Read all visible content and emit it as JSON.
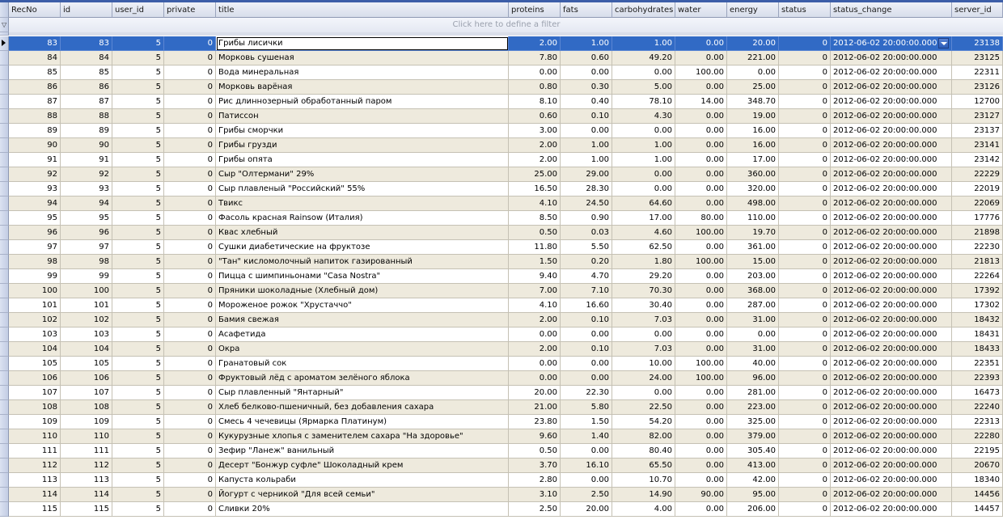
{
  "filter_placeholder": "Click here to define a filter",
  "columns": [
    "RecNo",
    "id",
    "user_id",
    "private",
    "title",
    "proteins",
    "fats",
    "carbohydrates",
    "water",
    "energy",
    "status",
    "status_change",
    "server_id"
  ],
  "selected_index": 0,
  "rows": [
    [
      "83",
      "83",
      "5",
      "0",
      "Грибы лисички",
      "2.00",
      "1.00",
      "1.00",
      "0.00",
      "20.00",
      "0",
      "2012-06-02 20:00:00.000",
      "23138"
    ],
    [
      "84",
      "84",
      "5",
      "0",
      "Морковь сушеная",
      "7.80",
      "0.60",
      "49.20",
      "0.00",
      "221.00",
      "0",
      "2012-06-02 20:00:00.000",
      "23125"
    ],
    [
      "85",
      "85",
      "5",
      "0",
      "Вода минеральная",
      "0.00",
      "0.00",
      "0.00",
      "100.00",
      "0.00",
      "0",
      "2012-06-02 20:00:00.000",
      "22311"
    ],
    [
      "86",
      "86",
      "5",
      "0",
      "Морковь варёная",
      "0.80",
      "0.30",
      "5.00",
      "0.00",
      "25.00",
      "0",
      "2012-06-02 20:00:00.000",
      "23126"
    ],
    [
      "87",
      "87",
      "5",
      "0",
      "Рис длиннозерный обработанный паром",
      "8.10",
      "0.40",
      "78.10",
      "14.00",
      "348.70",
      "0",
      "2012-06-02 20:00:00.000",
      "12700"
    ],
    [
      "88",
      "88",
      "5",
      "0",
      "Патиссон",
      "0.60",
      "0.10",
      "4.30",
      "0.00",
      "19.00",
      "0",
      "2012-06-02 20:00:00.000",
      "23127"
    ],
    [
      "89",
      "89",
      "5",
      "0",
      "Грибы сморчки",
      "3.00",
      "0.00",
      "0.00",
      "0.00",
      "16.00",
      "0",
      "2012-06-02 20:00:00.000",
      "23137"
    ],
    [
      "90",
      "90",
      "5",
      "0",
      "Грибы грузди",
      "2.00",
      "1.00",
      "1.00",
      "0.00",
      "16.00",
      "0",
      "2012-06-02 20:00:00.000",
      "23141"
    ],
    [
      "91",
      "91",
      "5",
      "0",
      "Грибы опята",
      "2.00",
      "1.00",
      "1.00",
      "0.00",
      "17.00",
      "0",
      "2012-06-02 20:00:00.000",
      "23142"
    ],
    [
      "92",
      "92",
      "5",
      "0",
      "Сыр \"Олтермани\" 29%",
      "25.00",
      "29.00",
      "0.00",
      "0.00",
      "360.00",
      "0",
      "2012-06-02 20:00:00.000",
      "22229"
    ],
    [
      "93",
      "93",
      "5",
      "0",
      "Сыр плавленый \"Российский\" 55%",
      "16.50",
      "28.30",
      "0.00",
      "0.00",
      "320.00",
      "0",
      "2012-06-02 20:00:00.000",
      "22019"
    ],
    [
      "94",
      "94",
      "5",
      "0",
      "Твикс",
      "4.10",
      "24.50",
      "64.60",
      "0.00",
      "498.00",
      "0",
      "2012-06-02 20:00:00.000",
      "22069"
    ],
    [
      "95",
      "95",
      "5",
      "0",
      "Фасоль красная Rainsow (Италия)",
      "8.50",
      "0.90",
      "17.00",
      "80.00",
      "110.00",
      "0",
      "2012-06-02 20:00:00.000",
      "17776"
    ],
    [
      "96",
      "96",
      "5",
      "0",
      "Квас хлебный",
      "0.50",
      "0.03",
      "4.60",
      "100.00",
      "19.70",
      "0",
      "2012-06-02 20:00:00.000",
      "21898"
    ],
    [
      "97",
      "97",
      "5",
      "0",
      "Сушки диабетические на фруктозе",
      "11.80",
      "5.50",
      "62.50",
      "0.00",
      "361.00",
      "0",
      "2012-06-02 20:00:00.000",
      "22230"
    ],
    [
      "98",
      "98",
      "5",
      "0",
      "\"Тан\" кисломолочный напиток газированный",
      "1.50",
      "0.20",
      "1.80",
      "100.00",
      "15.00",
      "0",
      "2012-06-02 20:00:00.000",
      "21813"
    ],
    [
      "99",
      "99",
      "5",
      "0",
      "Пицца с шимпиньонами \"Casa Nostra\"",
      "9.40",
      "4.70",
      "29.20",
      "0.00",
      "203.00",
      "0",
      "2012-06-02 20:00:00.000",
      "22264"
    ],
    [
      "100",
      "100",
      "5",
      "0",
      "Пряники шоколадные  (Хлебный дом)",
      "7.00",
      "7.10",
      "70.30",
      "0.00",
      "368.00",
      "0",
      "2012-06-02 20:00:00.000",
      "17392"
    ],
    [
      "101",
      "101",
      "5",
      "0",
      "Мороженое рожок \"Хрустаччо\"",
      "4.10",
      "16.60",
      "30.40",
      "0.00",
      "287.00",
      "0",
      "2012-06-02 20:00:00.000",
      "17302"
    ],
    [
      "102",
      "102",
      "5",
      "0",
      "Бамия свежая",
      "2.00",
      "0.10",
      "7.03",
      "0.00",
      "31.00",
      "0",
      "2012-06-02 20:00:00.000",
      "18432"
    ],
    [
      "103",
      "103",
      "5",
      "0",
      "Асафетида",
      "0.00",
      "0.00",
      "0.00",
      "0.00",
      "0.00",
      "0",
      "2012-06-02 20:00:00.000",
      "18431"
    ],
    [
      "104",
      "104",
      "5",
      "0",
      "Окра",
      "2.00",
      "0.10",
      "7.03",
      "0.00",
      "31.00",
      "0",
      "2012-06-02 20:00:00.000",
      "18433"
    ],
    [
      "105",
      "105",
      "5",
      "0",
      "Гранатовый сок",
      "0.00",
      "0.00",
      "10.00",
      "100.00",
      "40.00",
      "0",
      "2012-06-02 20:00:00.000",
      "22351"
    ],
    [
      "106",
      "106",
      "5",
      "0",
      "Фруктовый лёд с ароматом зелёного яблока",
      "0.00",
      "0.00",
      "24.00",
      "100.00",
      "96.00",
      "0",
      "2012-06-02 20:00:00.000",
      "22393"
    ],
    [
      "107",
      "107",
      "5",
      "0",
      "Сыр плавленный \"Янтарный\"",
      "20.00",
      "22.30",
      "0.00",
      "0.00",
      "281.00",
      "0",
      "2012-06-02 20:00:00.000",
      "16473"
    ],
    [
      "108",
      "108",
      "5",
      "0",
      "Хлеб белково-пшеничный, без добавления сахара",
      "21.00",
      "5.80",
      "22.50",
      "0.00",
      "223.00",
      "0",
      "2012-06-02 20:00:00.000",
      "22240"
    ],
    [
      "109",
      "109",
      "5",
      "0",
      "Смесь 4 чечевицы (Ярмарка Платинум)",
      "23.80",
      "1.50",
      "54.20",
      "0.00",
      "325.00",
      "0",
      "2012-06-02 20:00:00.000",
      "22313"
    ],
    [
      "110",
      "110",
      "5",
      "0",
      "Кукурузные хлопья с заменителем сахара \"На здоровье\"",
      "9.60",
      "1.40",
      "82.00",
      "0.00",
      "379.00",
      "0",
      "2012-06-02 20:00:00.000",
      "22280"
    ],
    [
      "111",
      "111",
      "5",
      "0",
      "Зефир \"Ланеж\" ванильный",
      "0.50",
      "0.00",
      "80.40",
      "0.00",
      "305.40",
      "0",
      "2012-06-02 20:00:00.000",
      "22195"
    ],
    [
      "112",
      "112",
      "5",
      "0",
      "Десерт \"Бонжур суфле\" Шоколадный крем",
      "3.70",
      "16.10",
      "65.50",
      "0.00",
      "413.00",
      "0",
      "2012-06-02 20:00:00.000",
      "20670"
    ],
    [
      "113",
      "113",
      "5",
      "0",
      "Капуста кольраби",
      "2.80",
      "0.00",
      "10.70",
      "0.00",
      "42.00",
      "0",
      "2012-06-02 20:00:00.000",
      "18340"
    ],
    [
      "114",
      "114",
      "5",
      "0",
      "Йогурт с черникой \"Для всей семьи\"",
      "3.10",
      "2.50",
      "14.90",
      "90.00",
      "95.00",
      "0",
      "2012-06-02 20:00:00.000",
      "14456"
    ],
    [
      "115",
      "115",
      "5",
      "0",
      "Сливки 20%",
      "2.50",
      "20.00",
      "4.00",
      "0.00",
      "206.00",
      "0",
      "2012-06-02 20:00:00.000",
      "14457"
    ]
  ],
  "colors": {
    "alt_row": "#eeeadd",
    "selection": "#316ac5",
    "header": "#d6dcea"
  }
}
